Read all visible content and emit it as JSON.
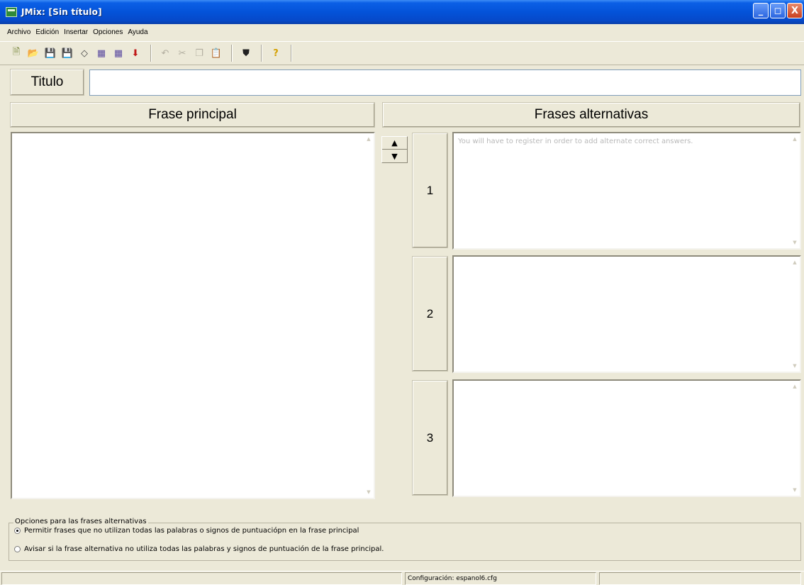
{
  "window": {
    "title": "JMix: [Sin título]"
  },
  "window_controls": {
    "minimize": "_",
    "maximize": "◻",
    "close": "X"
  },
  "menu": [
    "Archivo",
    "Edición",
    "Insertar",
    "Opciones",
    "Ayuda"
  ],
  "toolbar": {
    "buttons": [
      {
        "icon": "new-file-icon",
        "glyph": "🗎"
      },
      {
        "icon": "open-folder-icon",
        "glyph": "📂"
      },
      {
        "icon": "save-icon",
        "glyph": "💾"
      },
      {
        "icon": "save-as-icon",
        "glyph": "💾"
      },
      {
        "icon": "eraser-icon",
        "glyph": "◇"
      },
      {
        "icon": "create-web-page-icon",
        "glyph": "▦"
      },
      {
        "icon": "create-drag-page-icon",
        "glyph": "▦"
      },
      {
        "icon": "export-icon",
        "glyph": "⬇"
      },
      {
        "icon": "undo-icon",
        "glyph": "↶"
      },
      {
        "icon": "cut-icon",
        "glyph": "✂"
      },
      {
        "icon": "copy-icon",
        "glyph": "❐"
      },
      {
        "icon": "paste-icon",
        "glyph": "📋"
      },
      {
        "icon": "config-icon",
        "glyph": "⛊"
      },
      {
        "icon": "help-icon",
        "glyph": "?"
      }
    ]
  },
  "titulo": {
    "label": "Titulo",
    "value": ""
  },
  "main_sentence": {
    "header": "Frase principal",
    "value": ""
  },
  "alternatives": {
    "header": "Frases alternativas",
    "placeholder": "You will have to register in order to add alternate correct answers.",
    "items": [
      {
        "number": "1"
      },
      {
        "number": "2"
      },
      {
        "number": "3"
      }
    ],
    "move_up": "▲",
    "move_down": "▼"
  },
  "options": {
    "legend": "Opciones para las frases alternativas",
    "choices": [
      {
        "label": "Permitir frases que no utilizan todas las palabras o signos de puntuaciópn en la frase principal",
        "checked": true
      },
      {
        "label": "Avisar si la frase alternativa no utiliza todas las palabras y signos de puntuación de la frase principal.",
        "checked": false
      }
    ]
  },
  "status": {
    "left": "",
    "config": "Configuración: espanol6.cfg",
    "right": ""
  }
}
